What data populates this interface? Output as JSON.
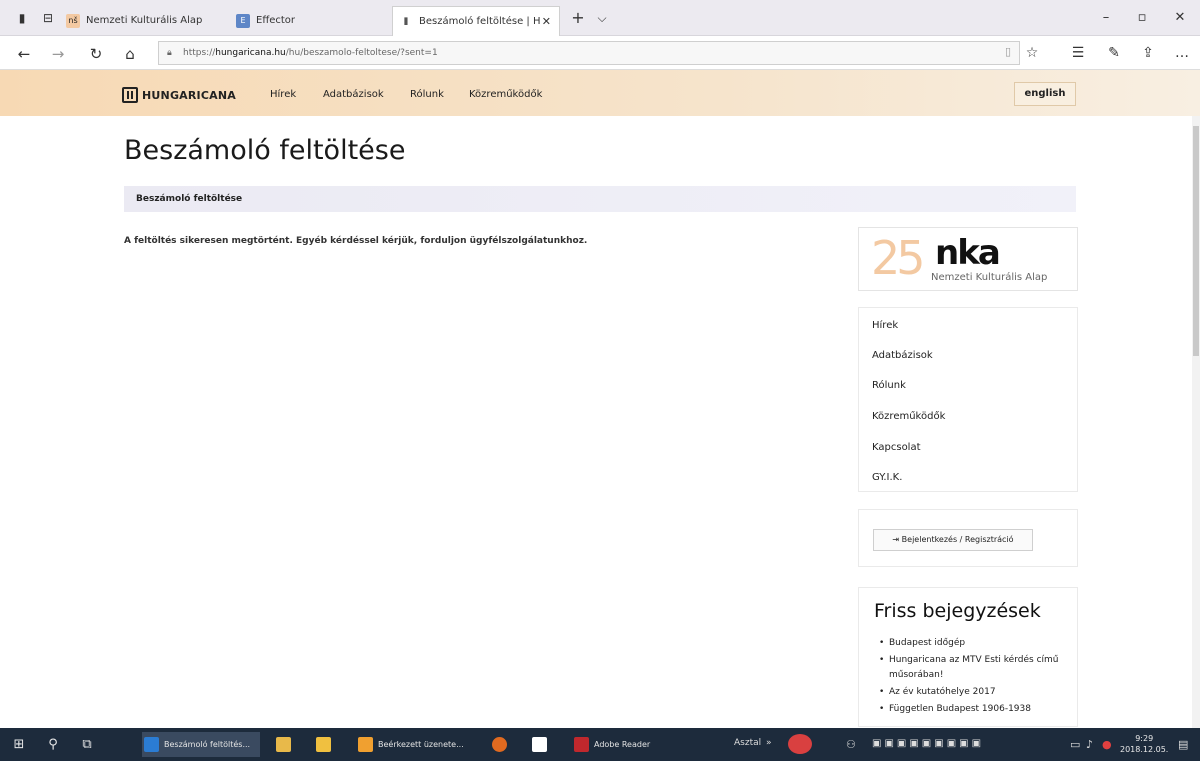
{
  "browser": {
    "tabs": [
      {
        "label": "Nemzeti Kulturális Alap",
        "favicon": "nka-icon"
      },
      {
        "label": "Effector",
        "favicon": "effector-icon"
      },
      {
        "label": "Beszámoló feltöltése | H",
        "favicon": "hungaricana-icon"
      }
    ],
    "url_prefix": "https://",
    "url_host": "hungaricana.hu",
    "url_path": "/hu/beszamolo-feltoltese/?sent=1"
  },
  "site": {
    "logo_text": "HUNGARICANA",
    "nav": [
      "Hírek",
      "Adatbázisok",
      "Rólunk",
      "Közreműködők"
    ],
    "lang_button": "english"
  },
  "page": {
    "title": "Beszámoló feltöltése",
    "breadcrumb": "Beszámoló feltöltése",
    "message": "A feltöltés sikeresen megtörtént. Egyéb kérdéssel kérjük, forduljon",
    "message_link": "ügyfélszolgálatunkhoz."
  },
  "sidebar": {
    "sponsor_number": "25",
    "sponsor_logo": "nka",
    "sponsor_name": "Nemzeti Kulturális Alap",
    "menu": [
      "Hírek",
      "Adatbázisok",
      "Rólunk",
      "Közreműködők",
      "Kapcsolat",
      "GY.I.K."
    ],
    "login_label": "Bejelentkezés / Regisztráció",
    "recent_title": "Friss bejegyzések",
    "recent_items": [
      "Budapest időgép",
      "Hungaricana az MTV Esti kérdés című műsorában!",
      "Az év kutatóhelye 2017",
      "Független Budapest 1906-1938"
    ]
  },
  "taskbar": {
    "apps": [
      {
        "label": "Beszámoló feltöltés...",
        "color": "#2b7cd3"
      },
      {
        "label": "",
        "color": "#e8b94a"
      },
      {
        "label": "",
        "color": "#f0c040"
      },
      {
        "label": "Beérkezett üzenete...",
        "color": "#f0a030"
      },
      {
        "label": "",
        "color": "#e06a20"
      },
      {
        "label": "",
        "color": "#ffffff"
      },
      {
        "label": "Adobe Reader",
        "color": "#c0282d"
      }
    ],
    "desktop_label": "Asztal",
    "time": "9:29",
    "date": "2018.12.05."
  }
}
